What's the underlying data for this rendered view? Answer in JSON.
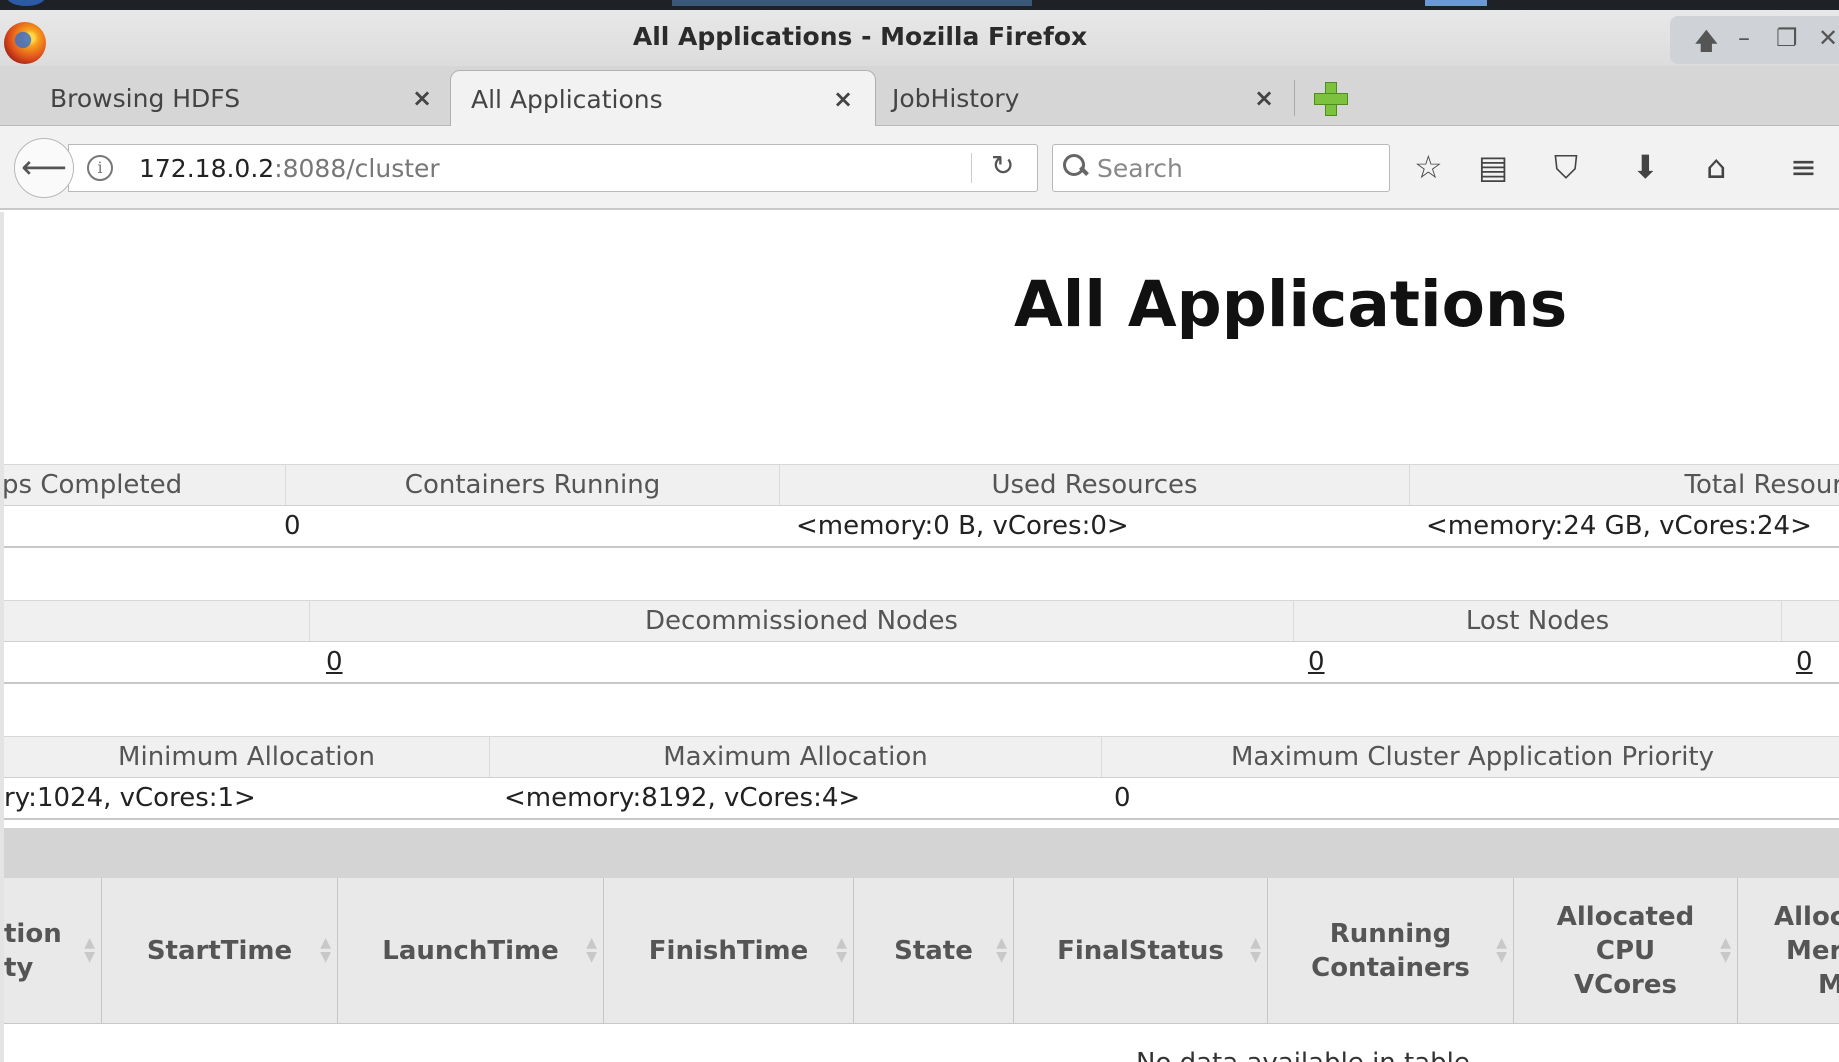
{
  "window": {
    "title": "All Applications - Mozilla Firefox"
  },
  "tabs": [
    {
      "label": "Browsing HDFS",
      "active": false
    },
    {
      "label": "All Applications",
      "active": true
    },
    {
      "label": "JobHistory",
      "active": false
    }
  ],
  "icons": {
    "close": "×",
    "back": "⟵",
    "info": "i",
    "reload": "↻",
    "bookmark": "☆",
    "reader": "▤",
    "pocket": "⛉",
    "download": "⬇",
    "home": "⌂",
    "menu": "≡",
    "win_up": "🡅",
    "win_min": "–",
    "win_restore": "❐",
    "win_close": "✕"
  },
  "navbar": {
    "url_host": "172.18.0.2",
    "url_path": ":8088/cluster",
    "search_placeholder": "Search"
  },
  "page": {
    "title": "All Applications"
  },
  "metrics_row1": {
    "headers": [
      "ps Completed",
      "Containers Running",
      "Used Resources",
      "Total Resour"
    ],
    "values": [
      "0",
      "<memory:0 B, vCores:0>",
      "<memory:24 GB, vCores:24>"
    ]
  },
  "metrics_row2": {
    "headers": [
      "",
      "Decommissioned Nodes",
      "Lost Nodes",
      ""
    ],
    "values": [
      "0",
      "0",
      "0"
    ]
  },
  "metrics_row3": {
    "headers": [
      "Minimum Allocation",
      "Maximum Allocation",
      "Maximum Cluster Application Priority"
    ],
    "values": [
      "ry:1024, vCores:1>",
      "<memory:8192, vCores:4>",
      "0"
    ]
  },
  "apps_table": {
    "columns": [
      [
        "tion",
        "ty"
      ],
      [
        "StartTime"
      ],
      [
        "LaunchTime"
      ],
      [
        "FinishTime"
      ],
      [
        "State"
      ],
      [
        "FinalStatus"
      ],
      [
        "Running",
        "Containers"
      ],
      [
        "Allocated",
        "CPU",
        "VCores"
      ],
      [
        "Alloc",
        "Mer",
        "M"
      ]
    ],
    "empty_message": "No data available in table"
  }
}
